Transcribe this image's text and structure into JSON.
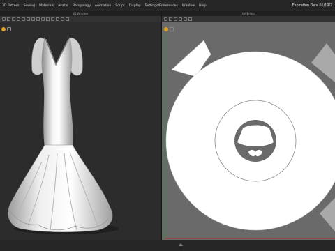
{
  "menu": {
    "items": [
      "3D Pattern",
      "Sewing",
      "Materials",
      "Avatar",
      "Retopology",
      "Animation",
      "Script",
      "Display",
      "Settings/Preferences",
      "Window",
      "Help"
    ],
    "expiration": "Expiration Date 01/19/2"
  },
  "windows": {
    "left_title": "3D Window",
    "right_title": "UV Editor"
  },
  "colors": {
    "menubar": "#262626",
    "viewport3d": "#2c2c2c",
    "viewport2d": "#6a6a6a",
    "uv_island": "#ffffff",
    "accent_icon": "#e0a020",
    "axis_green": "#3c8c3c",
    "axis_red": "#b03030"
  },
  "icons": {
    "left_view_icon": "sun-icon",
    "right_view_icon": "sun-icon"
  }
}
